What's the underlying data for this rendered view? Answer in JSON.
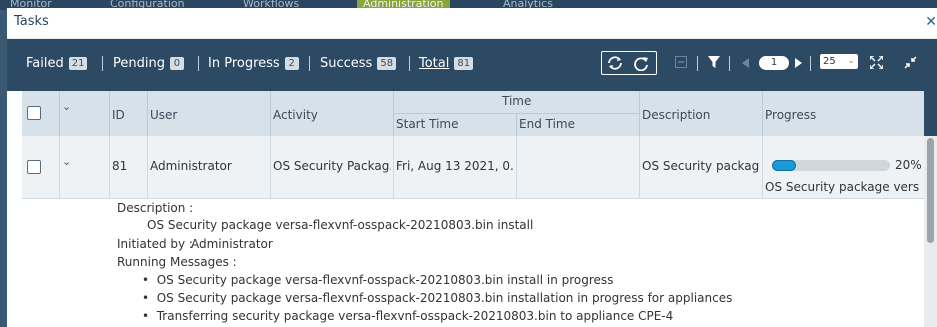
{
  "nav": {
    "items": [
      "Monitor",
      "Configuration",
      "Workflows",
      "Administration",
      "Analytics"
    ]
  },
  "dialog": {
    "title": "Tasks",
    "close_icon": "✕"
  },
  "stats": {
    "failed_label": "Failed",
    "failed_count": "21",
    "pending_label": "Pending",
    "pending_count": "0",
    "in_progress_label": "In Progress",
    "in_progress_count": "2",
    "success_label": "Success",
    "success_count": "58",
    "total_label": "Total",
    "total_count": "81"
  },
  "toolbar": {
    "page": "1",
    "per_page": "25",
    "icons": [
      "refresh-icon",
      "reload-icon",
      "collapse-icon",
      "filter-icon",
      "prev-page-icon",
      "next-page-icon",
      "expand-icon",
      "minimize-icon"
    ]
  },
  "table": {
    "headers": {
      "id": "ID",
      "user": "User",
      "activity": "Activity",
      "time": "Time",
      "start_time": "Start Time",
      "end_time": "End Time",
      "description": "Description",
      "progress": "Progress"
    },
    "rows": [
      {
        "id": "81",
        "user": "Administrator",
        "activity": "OS Security Packag...",
        "start_time": "Fri, Aug 13 2021, 0...",
        "end_time": "",
        "description": "OS Security packag...",
        "progress_percent": 20,
        "progress_label": "20%",
        "progress_text": "OS Security package vers..."
      }
    ]
  },
  "detail": {
    "description_label": "Description :",
    "description_value": "OS Security package versa-flexvnf-osspack-20210803.bin install",
    "initiated_label": "Initiated by :",
    "initiated_value": "Administrator",
    "messages_label": "Running Messages :",
    "messages": [
      "OS Security package versa-flexvnf-osspack-20210803.bin install in progress",
      "OS Security package versa-flexvnf-osspack-20210803.bin installation in progress for appliances",
      "Transferring security package versa-flexvnf-osspack-20210803.bin to appliance CPE-4"
    ]
  },
  "colors": {
    "accent": "#1a9ad6",
    "toolbar_bg": "#2c4a63",
    "header_bg": "#d6e1ea"
  }
}
